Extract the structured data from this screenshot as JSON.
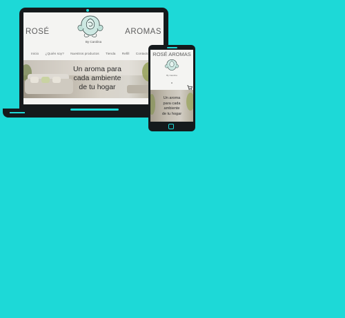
{
  "laptop": {
    "brand_left": "ROSÉ",
    "brand_right": "AROMAS",
    "logo_caption": "By Carolina",
    "nav_items": [
      "Inicio",
      "¿Quién soy?",
      "Nuestros productos",
      "Tienda",
      "Refill",
      "Contacto"
    ],
    "hero_lines": [
      "Un aroma para",
      "cada ambiente",
      "de tu hogar"
    ]
  },
  "phone": {
    "brand": "ROSÉ AROMAS",
    "logo_caption": "By Carolina",
    "hero_lines": [
      "Un aroma",
      "para cada",
      "ambiente",
      "de tu hogar"
    ]
  },
  "colors": {
    "background": "#1dd9d7",
    "device": "#151a1c",
    "screen": "#f4f4f2",
    "text": "#5d5d5d"
  },
  "icons": [
    "rose-logo-icon",
    "cart-icon"
  ]
}
